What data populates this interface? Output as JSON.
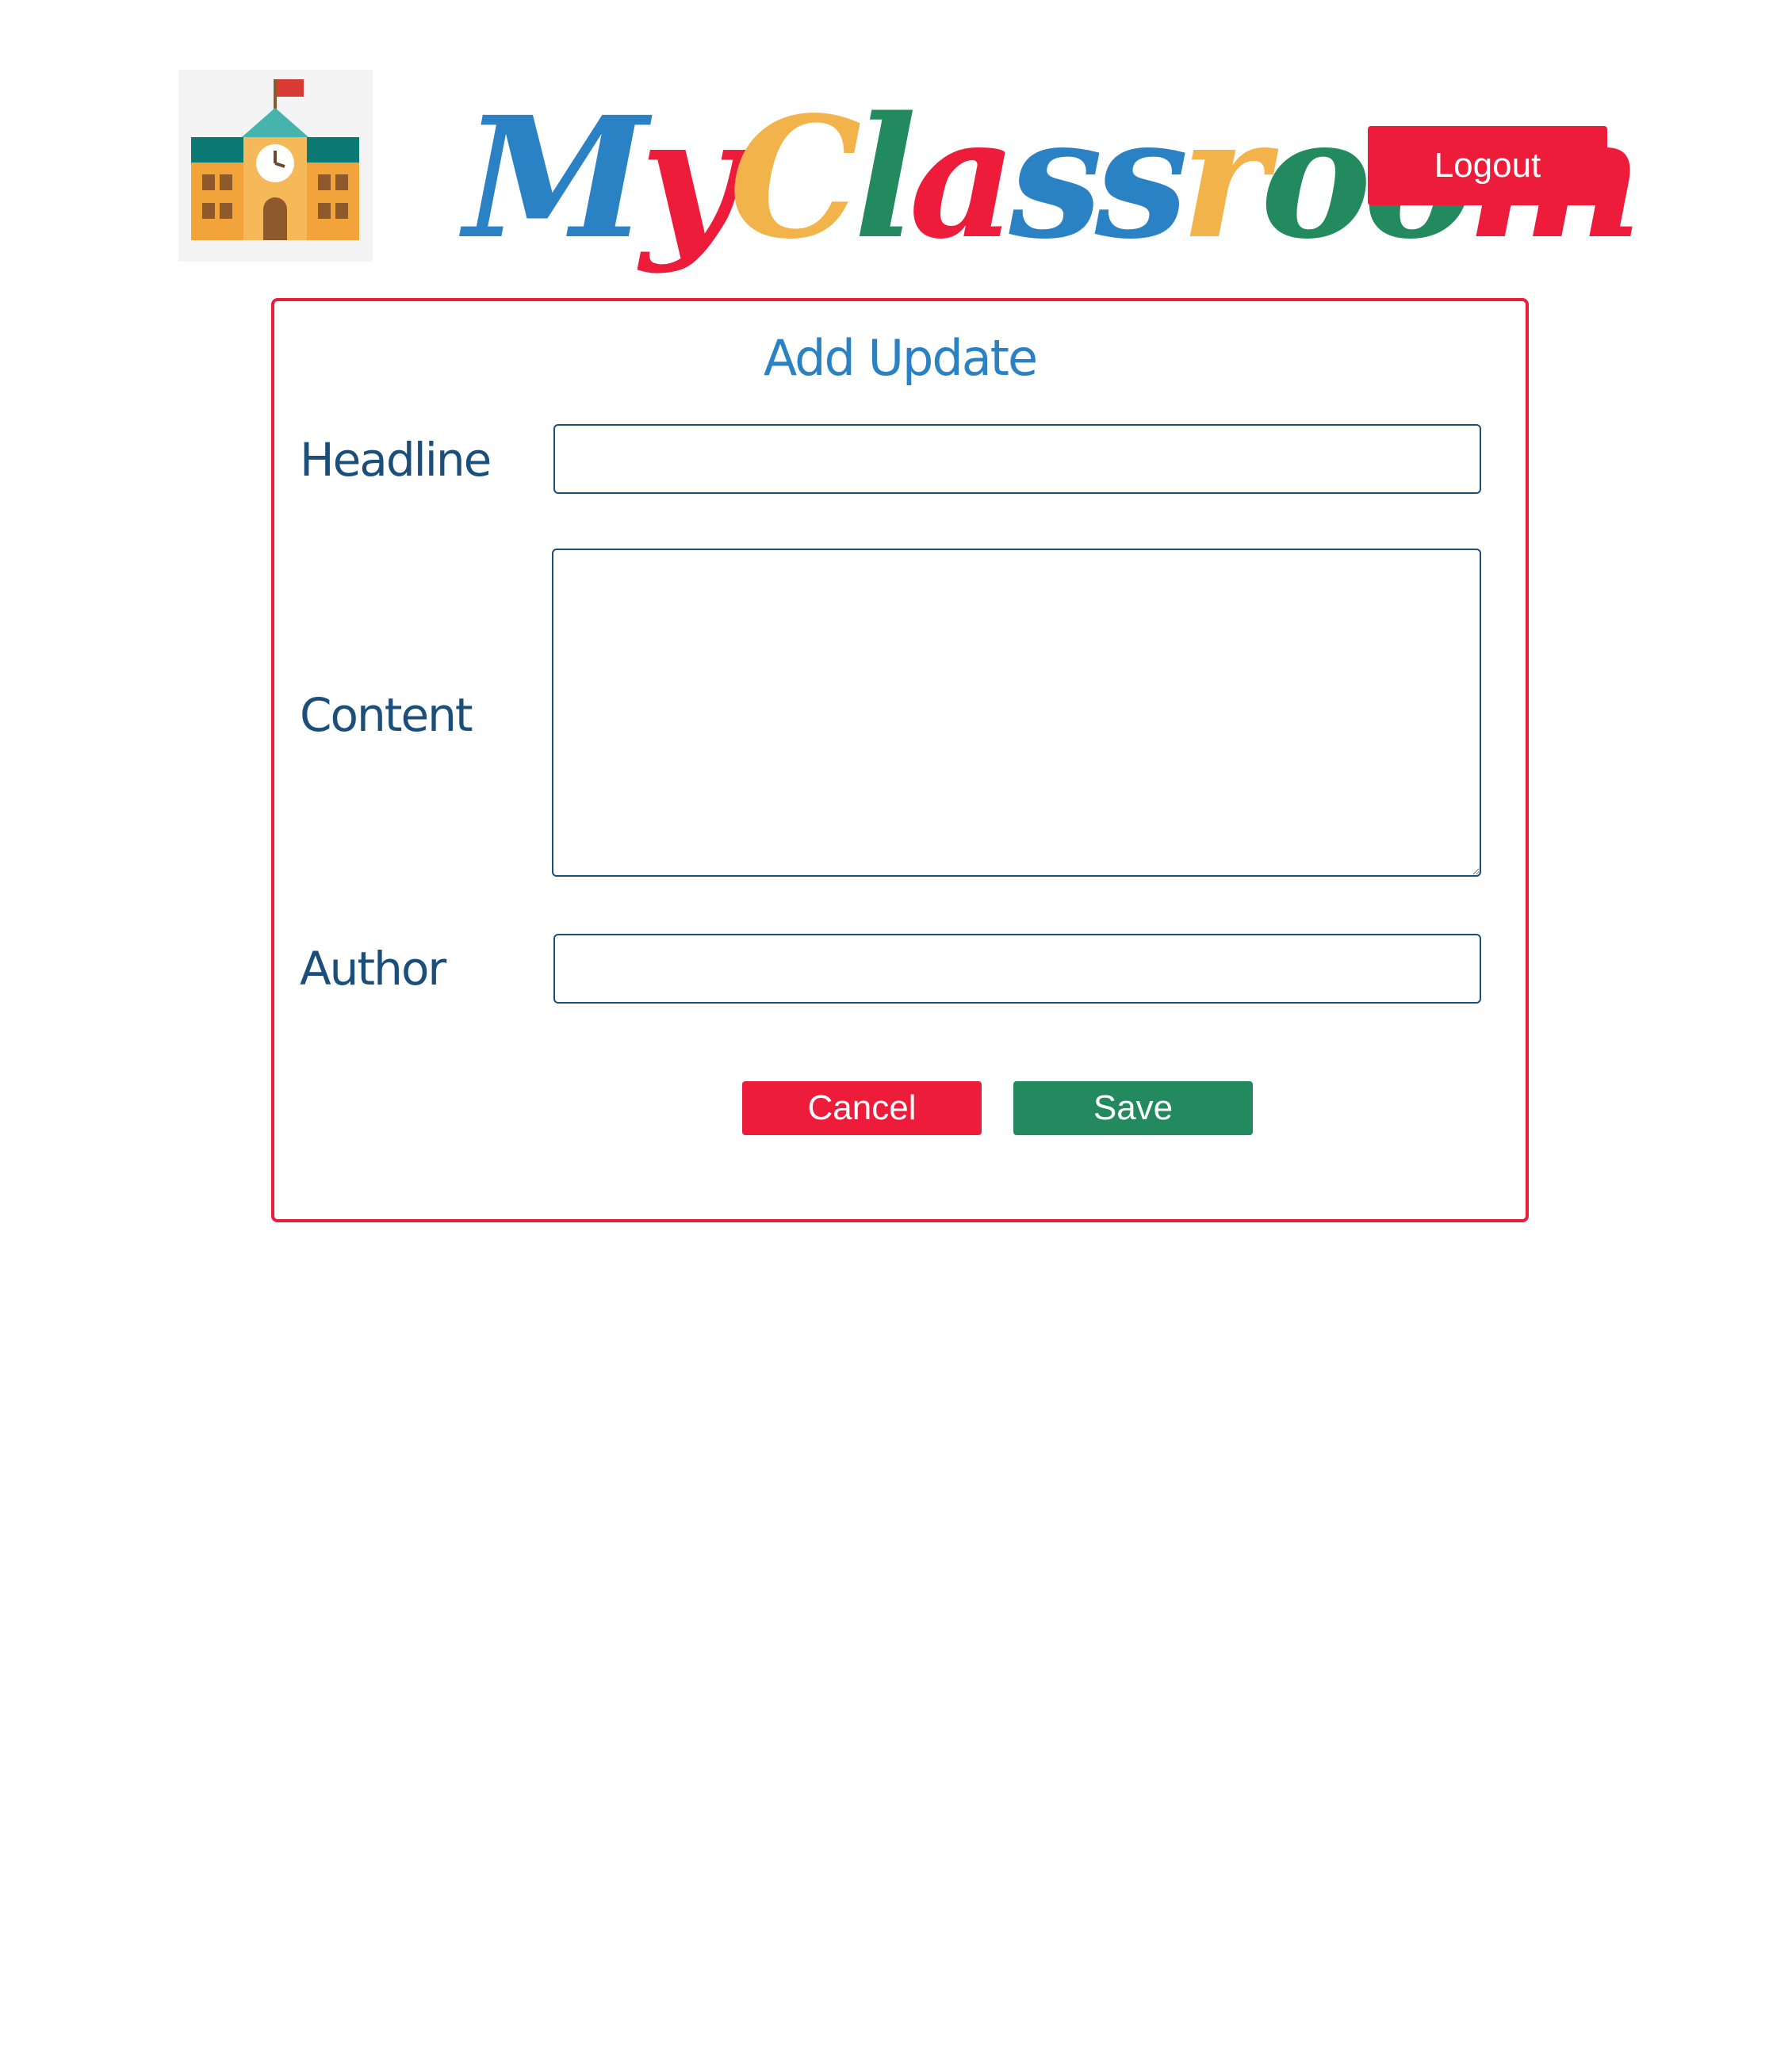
{
  "header": {
    "logo_icon": "school-building-icon",
    "brand_letters": [
      {
        "char": "M",
        "color": "#2a82c4"
      },
      {
        "char": "y",
        "color": "#ee1c3b"
      },
      {
        "char": "C",
        "color": "#f2b44a"
      },
      {
        "char": "l",
        "color": "#238a5f"
      },
      {
        "char": "a",
        "color": "#ee1c3b"
      },
      {
        "char": "s",
        "color": "#2a82c4"
      },
      {
        "char": "s",
        "color": "#2a82c4"
      },
      {
        "char": "r",
        "color": "#f2b44a"
      },
      {
        "char": "o",
        "color": "#238a5f"
      },
      {
        "char": "o",
        "color": "#238a5f"
      },
      {
        "char": "m",
        "color": "#ee1c3b"
      }
    ],
    "logout_label": "Logout"
  },
  "form": {
    "title": "Add Update",
    "fields": {
      "headline_label": "Headline",
      "headline_value": "",
      "content_label": "Content",
      "content_value": "",
      "author_label": "Author",
      "author_value": ""
    },
    "cancel_label": "Cancel",
    "save_label": "Save"
  },
  "colors": {
    "primary_red": "#ee1c3b",
    "save_green": "#238a5f",
    "title_blue": "#2a82c4",
    "label_navy": "#1b4e7a"
  }
}
